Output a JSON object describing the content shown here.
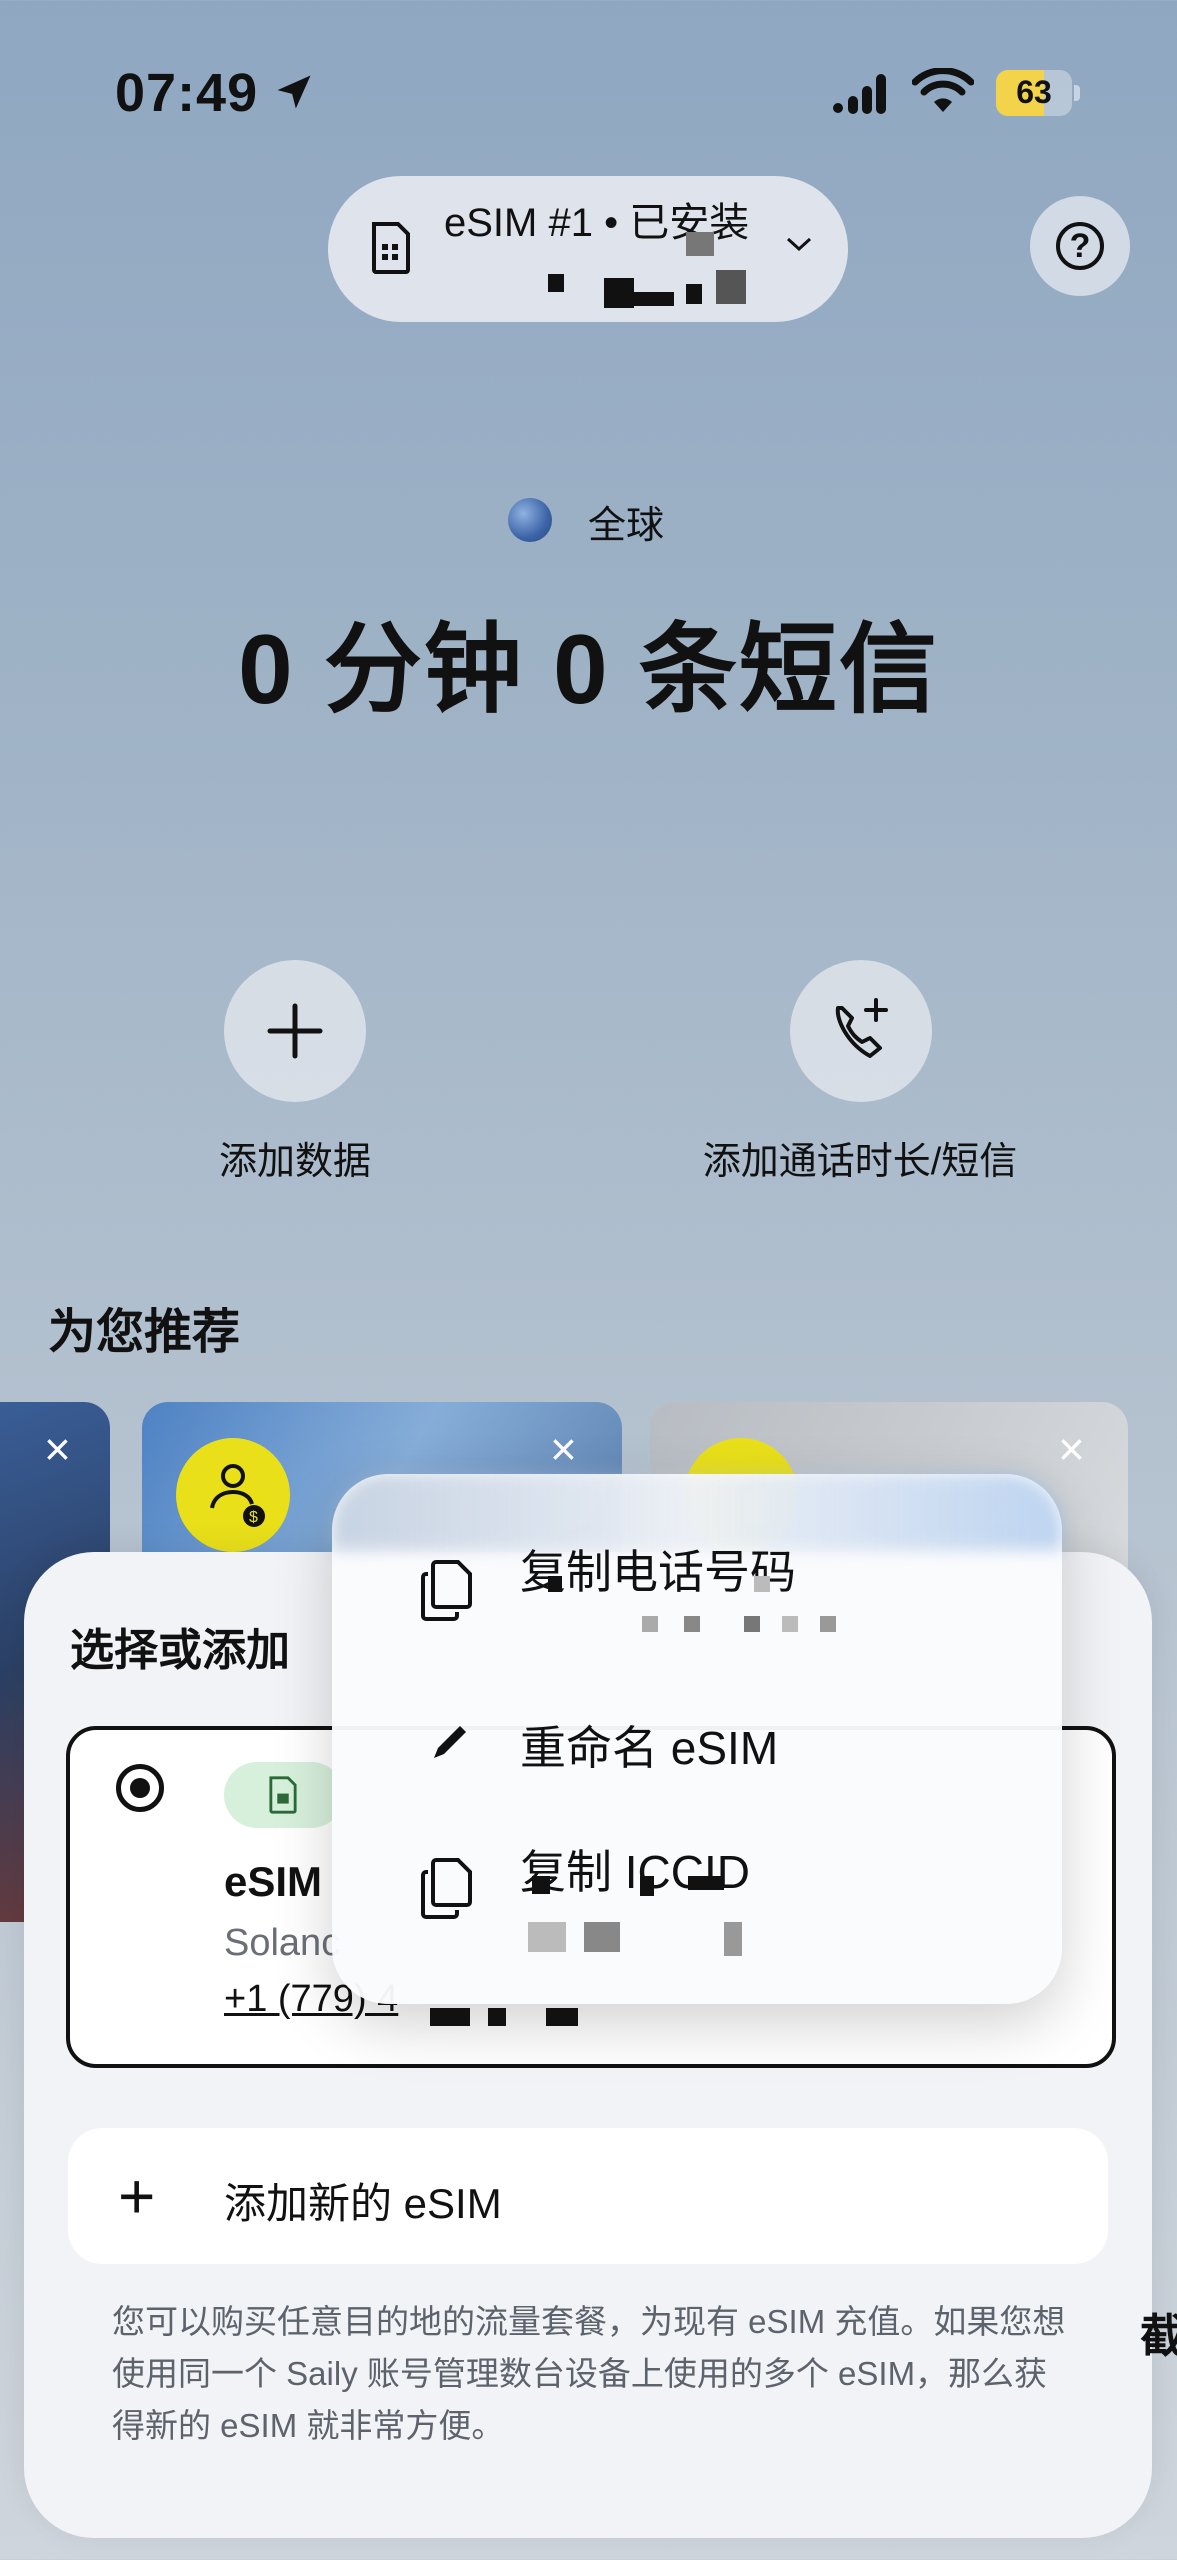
{
  "status_bar": {
    "time": "07:49",
    "battery": "63",
    "battery_level": 0.63
  },
  "header": {
    "esim_label": "eSIM #1 • 已安装"
  },
  "region": {
    "name": "全球"
  },
  "balance": {
    "headline": "0 分钟 0 条短信"
  },
  "actions": [
    {
      "label": "添加数据",
      "icon": "plus-icon"
    },
    {
      "label": "添加通话时长/短信",
      "icon": "phone-add-icon"
    }
  ],
  "recommend": {
    "title": "为您推荐"
  },
  "sheet": {
    "title": "选择或添加",
    "esim_card": {
      "name": "eSIM",
      "subtitle": "Solanc",
      "phone": "+1 (779) 4"
    },
    "add_new_label": "添加新的 eSIM",
    "note": "您可以购买任意目的地的流量套餐，为现有 eSIM 充值。如果您想使用同一个 Saily 账号管理数台设备上使用的多个 eSIM，那么获得新的 eSIM 就非常方便。"
  },
  "context_menu": {
    "items": [
      {
        "label": "复制电话号码",
        "icon": "copy-icon"
      },
      {
        "label": "重命名 eSIM",
        "icon": "pencil-icon"
      },
      {
        "label": "复制 ICCID",
        "icon": "copy-icon"
      }
    ]
  },
  "partial_text": "截"
}
